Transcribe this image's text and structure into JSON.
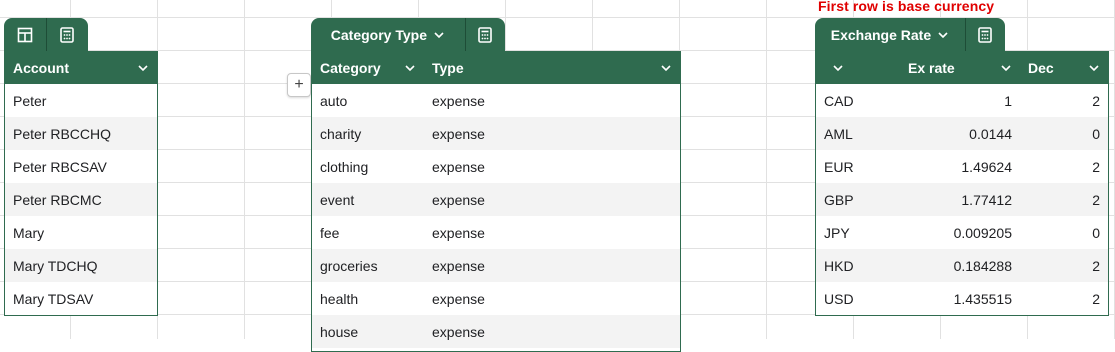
{
  "note": "First row is base currency",
  "account_table": {
    "header": "Account",
    "rows": [
      "Peter",
      "Peter RBCCHQ",
      "Peter RBCSAV",
      "Peter RBCMC",
      "Mary",
      "Mary TDCHQ",
      "Mary TDSAV"
    ]
  },
  "category_table": {
    "tab_title": "Category Type",
    "col_category": "Category",
    "col_type": "Type",
    "rows": [
      {
        "category": "auto",
        "type": "expense"
      },
      {
        "category": "charity",
        "type": "expense"
      },
      {
        "category": "clothing",
        "type": "expense"
      },
      {
        "category": "event",
        "type": "expense"
      },
      {
        "category": "fee",
        "type": "expense"
      },
      {
        "category": "groceries",
        "type": "expense"
      },
      {
        "category": "health",
        "type": "expense"
      },
      {
        "category": "house",
        "type": "expense"
      }
    ]
  },
  "exchange_table": {
    "tab_title": "Exchange Rate",
    "col_currency": "",
    "col_rate": "Ex rate",
    "col_dec": "Dec",
    "rows": [
      {
        "cur": "CAD",
        "rate": "1",
        "dec": "2"
      },
      {
        "cur": "AML",
        "rate": "0.0144",
        "dec": "0"
      },
      {
        "cur": "EUR",
        "rate": "1.49624",
        "dec": "2"
      },
      {
        "cur": "GBP",
        "rate": "1.77412",
        "dec": "2"
      },
      {
        "cur": "JPY",
        "rate": "0.009205",
        "dec": "0"
      },
      {
        "cur": "HKD",
        "rate": "0.184288",
        "dec": "2"
      },
      {
        "cur": "USD",
        "rate": "1.435515",
        "dec": "2"
      }
    ]
  },
  "add_button": "+",
  "colors": {
    "header": "#2f6b4f",
    "note": "#e00000"
  }
}
